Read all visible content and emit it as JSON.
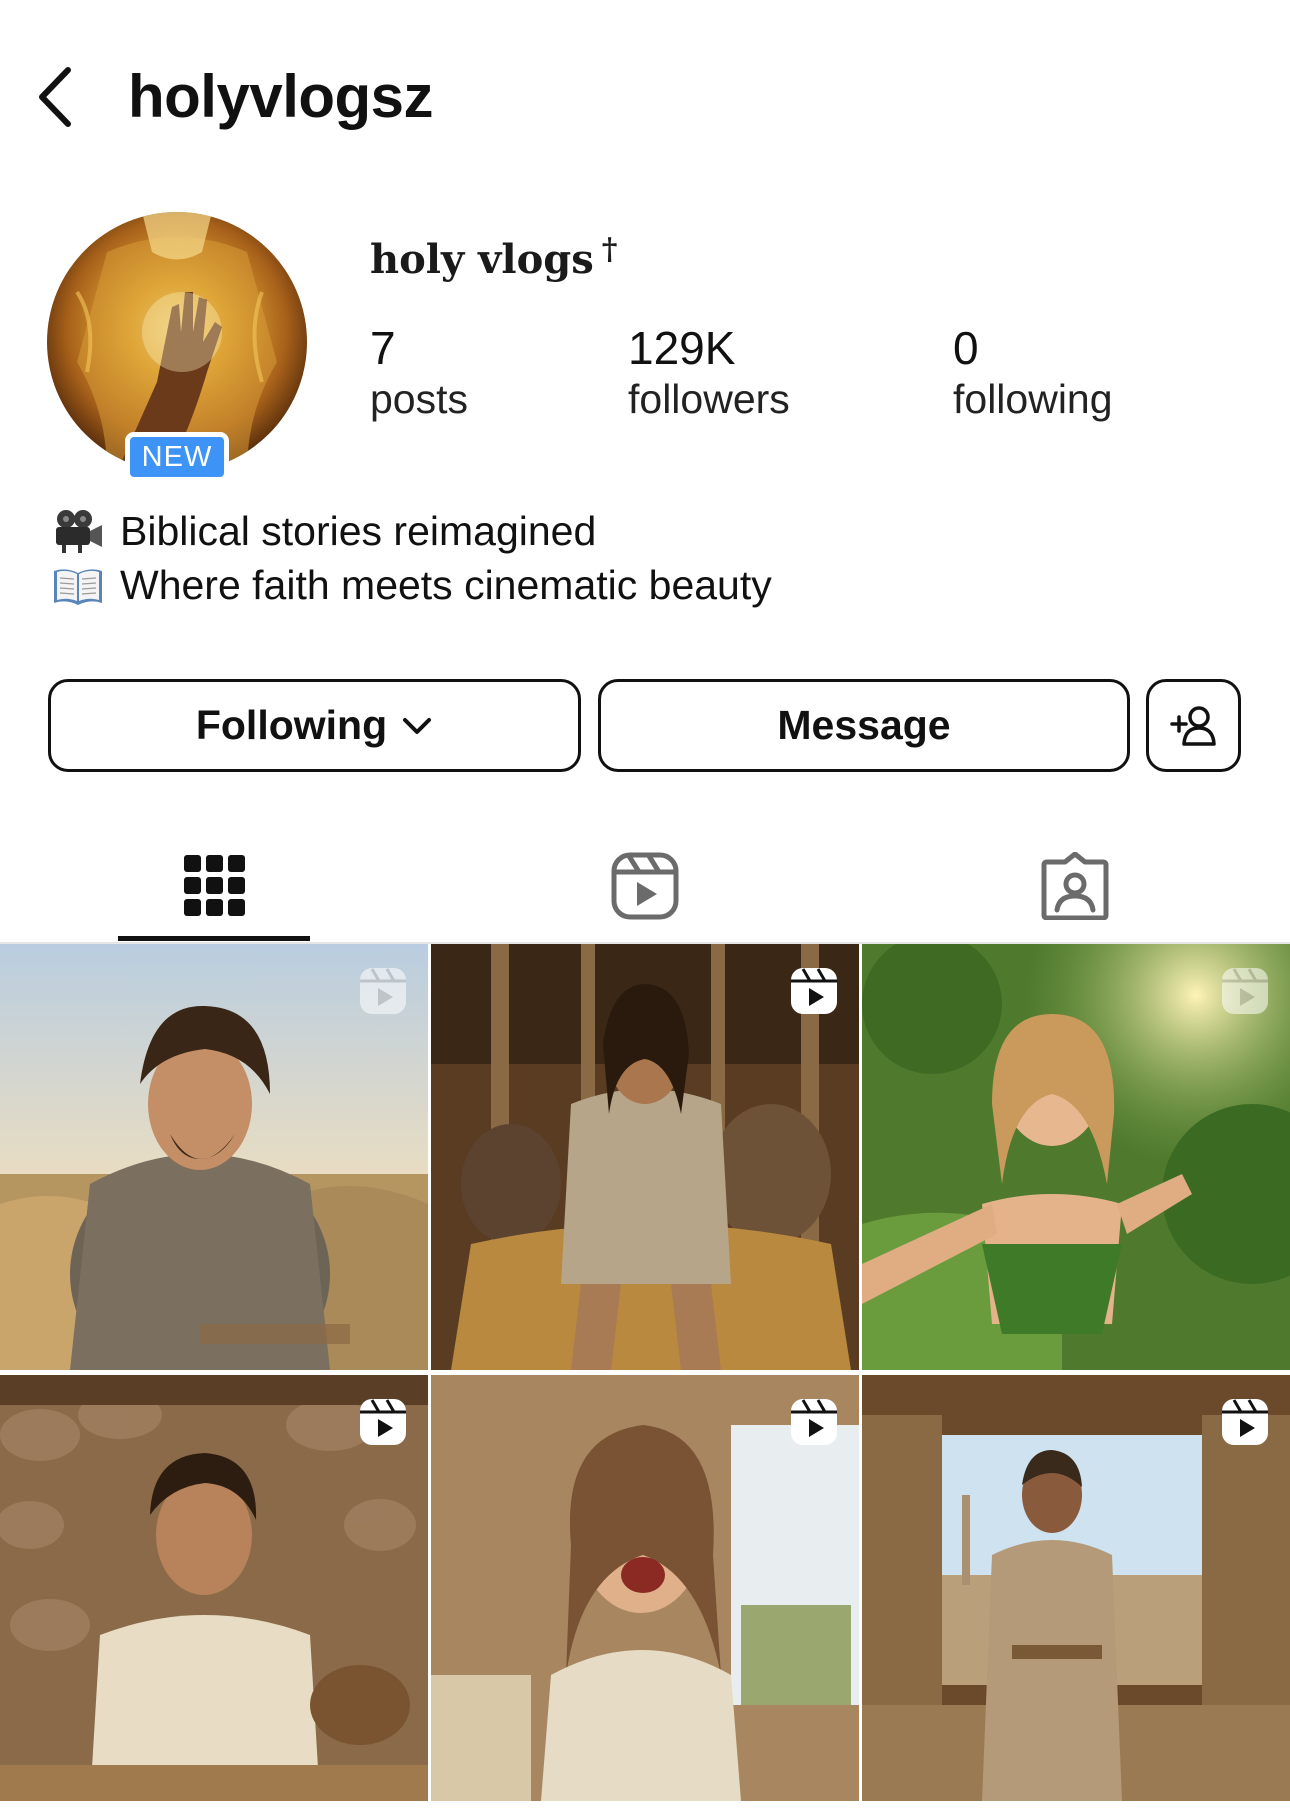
{
  "header": {
    "username": "holyvlogsz"
  },
  "profile": {
    "display_name": "holy vlogs",
    "display_name_symbol": "†",
    "new_badge": "NEW",
    "stats": {
      "posts": {
        "value": "7",
        "label": "posts"
      },
      "followers": {
        "value": "129K",
        "label": "followers"
      },
      "following": {
        "value": "0",
        "label": "following"
      }
    },
    "bio": [
      {
        "icon": "movie-camera-emoji",
        "text": "Biblical stories reimagined"
      },
      {
        "icon": "open-book-emoji",
        "text": "Where faith meets cinematic beauty"
      }
    ]
  },
  "actions": {
    "following_label": "Following",
    "message_label": "Message",
    "add_user_icon": "add-user-icon"
  },
  "tabs": [
    {
      "icon": "grid-icon",
      "active": true
    },
    {
      "icon": "reels-icon",
      "active": false
    },
    {
      "icon": "tagged-icon",
      "active": false
    }
  ],
  "grid": [
    {
      "type": "reel",
      "description_icon": "reel-icon"
    },
    {
      "type": "reel",
      "description_icon": "reel-icon"
    },
    {
      "type": "reel",
      "description_icon": "reel-icon"
    },
    {
      "type": "reel",
      "description_icon": "reel-icon"
    },
    {
      "type": "reel",
      "description_icon": "reel-icon"
    },
    {
      "type": "reel",
      "description_icon": "reel-icon"
    }
  ],
  "colors": {
    "badge_blue": "#3d94f6",
    "text": "#111111",
    "divider": "#e6e6e6"
  }
}
